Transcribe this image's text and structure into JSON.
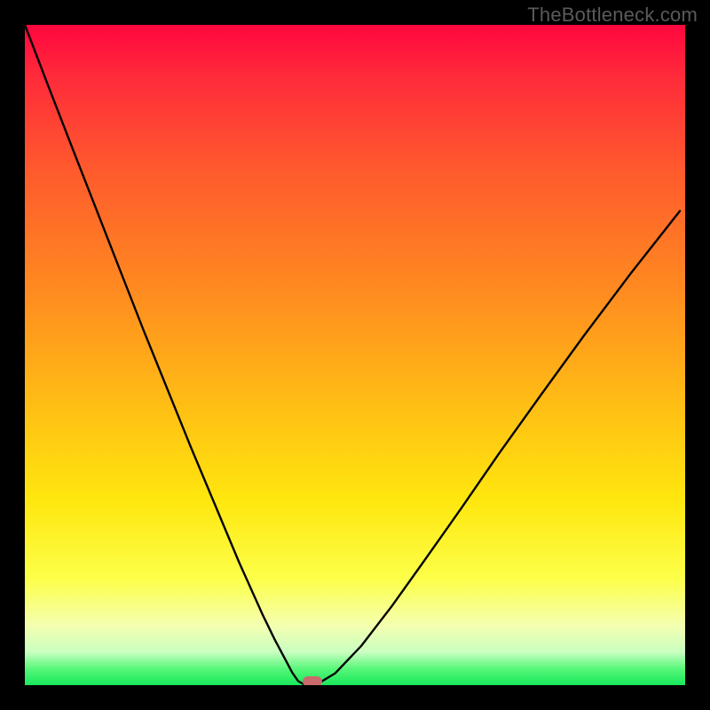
{
  "watermark": "TheBottleneck.com",
  "chart_data": {
    "type": "line",
    "title": "",
    "xlabel": "",
    "ylabel": "",
    "xlim": [
      0,
      1
    ],
    "ylim": [
      0,
      1
    ],
    "series": [
      {
        "name": "curve",
        "x": [
          0.0,
          0.036,
          0.072,
          0.108,
          0.144,
          0.18,
          0.216,
          0.252,
          0.288,
          0.324,
          0.36,
          0.378,
          0.396,
          0.405,
          0.414,
          0.425,
          0.44,
          0.47,
          0.51,
          0.556,
          0.606,
          0.661,
          0.719,
          0.782,
          0.848,
          0.918,
          0.992
        ],
        "y": [
          1.0,
          0.906,
          0.813,
          0.721,
          0.629,
          0.537,
          0.448,
          0.359,
          0.273,
          0.187,
          0.107,
          0.07,
          0.036,
          0.019,
          0.006,
          0.0,
          0.0,
          0.018,
          0.06,
          0.12,
          0.19,
          0.268,
          0.352,
          0.44,
          0.531,
          0.624,
          0.718
        ]
      }
    ],
    "marker": {
      "x": 0.435,
      "y": 0.0
    },
    "gradient_stops": [
      {
        "pos": 0.0,
        "color": "#FF063F"
      },
      {
        "pos": 0.08,
        "color": "#FF2B3A"
      },
      {
        "pos": 0.22,
        "color": "#FF5A2D"
      },
      {
        "pos": 0.4,
        "color": "#FF8A20"
      },
      {
        "pos": 0.56,
        "color": "#FFB915"
      },
      {
        "pos": 0.72,
        "color": "#FFE70E"
      },
      {
        "pos": 0.84,
        "color": "#FCFF4A"
      },
      {
        "pos": 0.91,
        "color": "#F4FFB0"
      },
      {
        "pos": 0.95,
        "color": "#C9FFC1"
      },
      {
        "pos": 0.975,
        "color": "#58F77A"
      },
      {
        "pos": 1.0,
        "color": "#18E85C"
      }
    ]
  }
}
